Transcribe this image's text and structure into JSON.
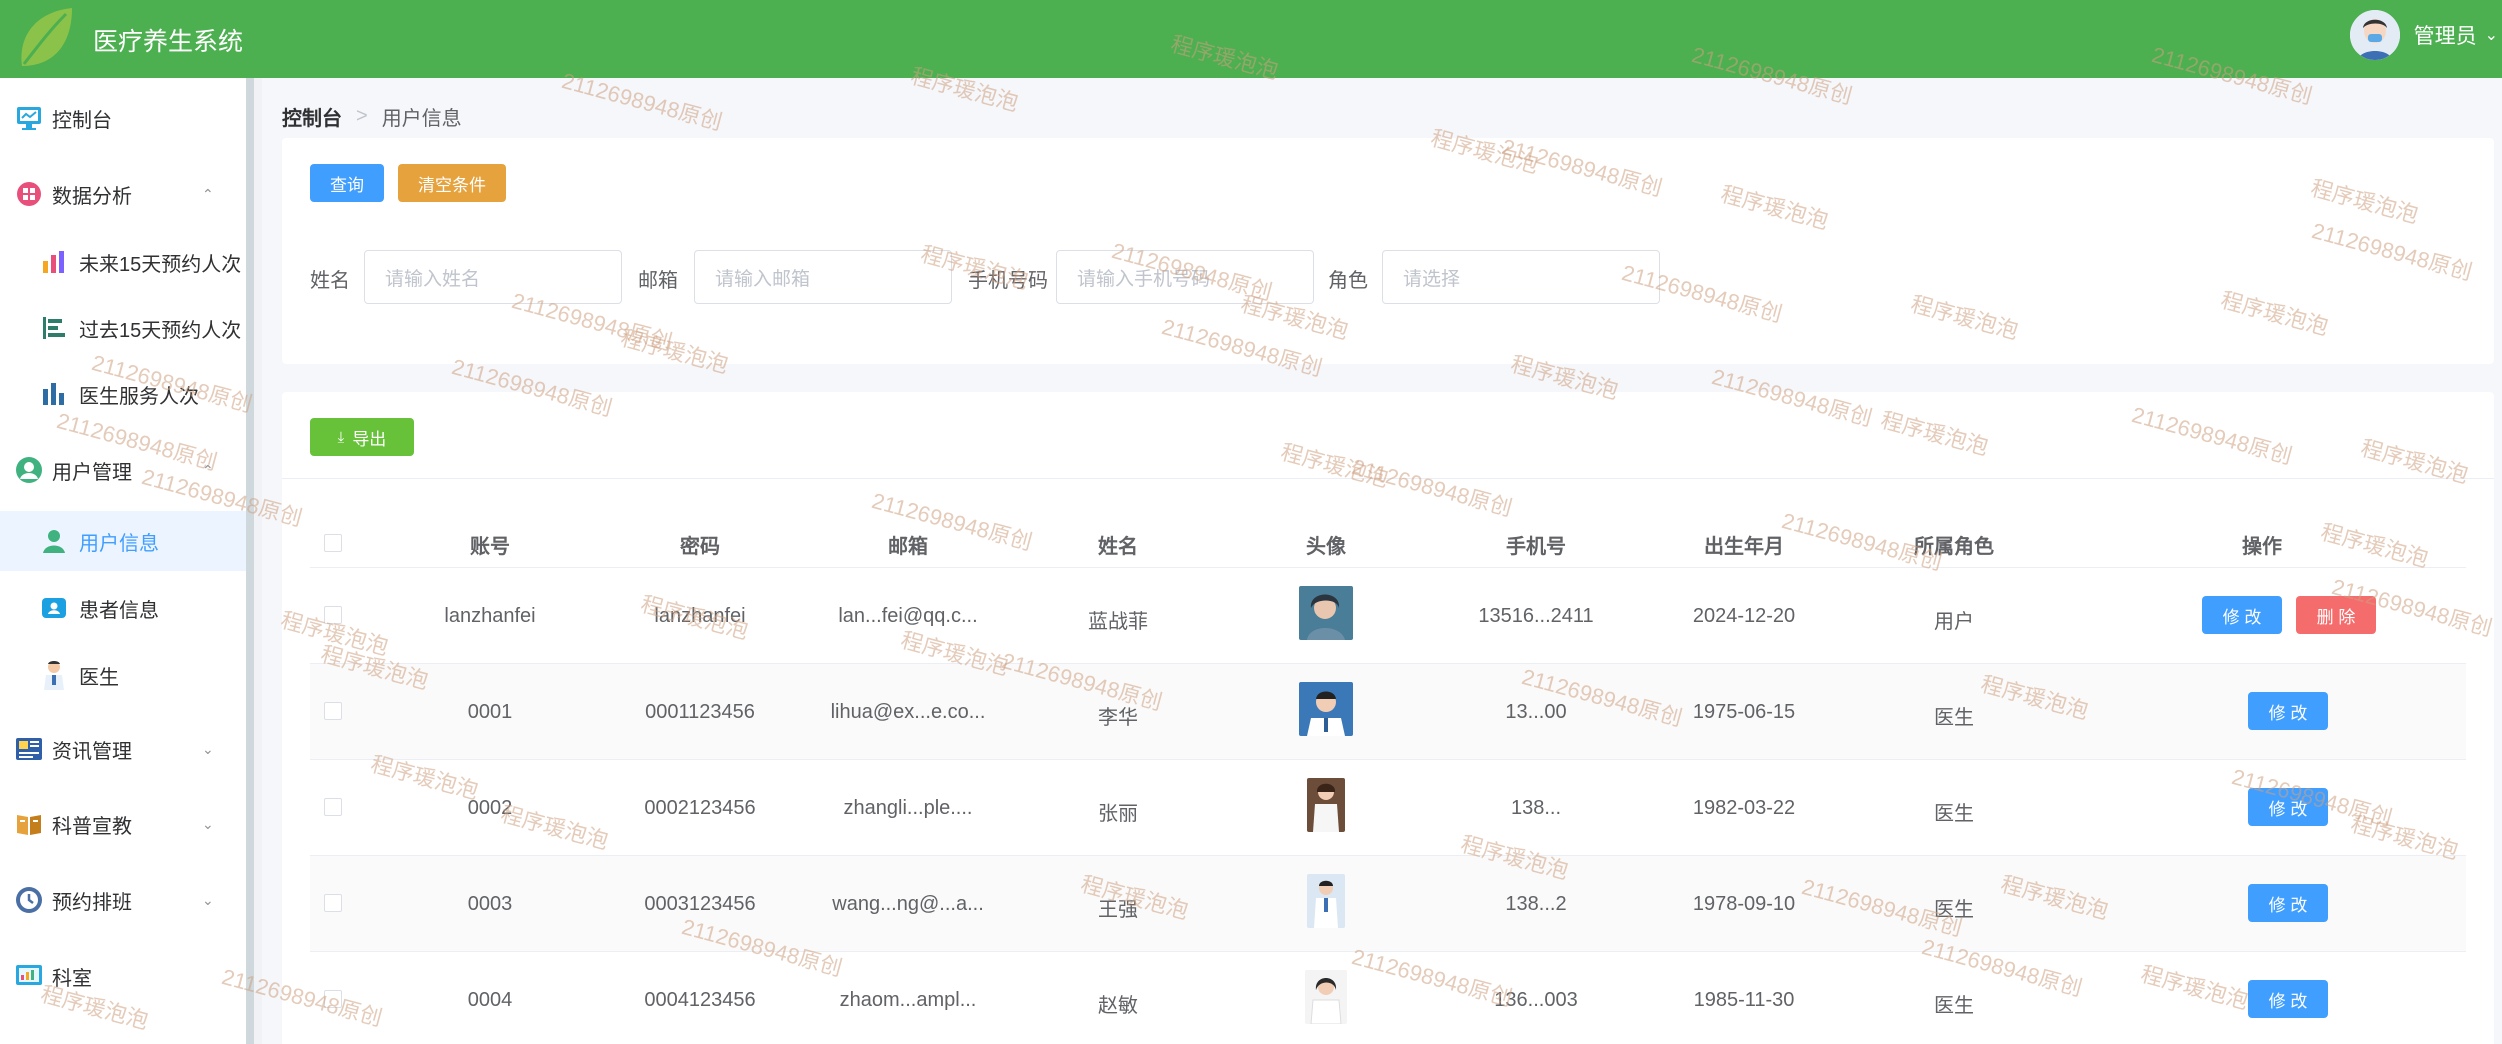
{
  "app": {
    "title": "医疗养生系统",
    "admin_name": "管理员"
  },
  "sidebar": {
    "items": [
      {
        "label": "控制台",
        "icon": "monitor-icon"
      },
      {
        "label": "数据分析",
        "icon": "chart-grid-icon",
        "expanded": true
      },
      {
        "label": "未来15天预约人次",
        "icon": "bar-chart-icon",
        "sub": true
      },
      {
        "label": "过去15天预约人次",
        "icon": "list-chart-icon",
        "sub": true
      },
      {
        "label": "医生服务人次",
        "icon": "column-chart-icon",
        "sub": true
      },
      {
        "label": "用户管理",
        "icon": "user-circle-icon",
        "expanded": true
      },
      {
        "label": "用户信息",
        "icon": "user-icon",
        "sub": true,
        "active": true
      },
      {
        "label": "患者信息",
        "icon": "id-card-icon",
        "sub": true
      },
      {
        "label": "医生",
        "icon": "doctor-icon",
        "sub": true
      },
      {
        "label": "资讯管理",
        "icon": "news-icon"
      },
      {
        "label": "科普宣教",
        "icon": "book-icon"
      },
      {
        "label": "预约排班",
        "icon": "schedule-icon"
      },
      {
        "label": "科室",
        "icon": "department-icon"
      }
    ]
  },
  "breadcrumb": {
    "home": "控制台",
    "current": "用户信息"
  },
  "search": {
    "query_label": "查询",
    "clear_label": "清空条件",
    "fields": [
      {
        "label": "姓名",
        "placeholder": "请输入姓名"
      },
      {
        "label": "邮箱",
        "placeholder": "请输入邮箱"
      },
      {
        "label": "手机号码",
        "placeholder": "请输入手机号码"
      },
      {
        "label": "角色",
        "placeholder": "请选择"
      }
    ]
  },
  "table": {
    "export_label": "导出",
    "headers": [
      "账号",
      "密码",
      "邮箱",
      "姓名",
      "头像",
      "手机号",
      "出生年月",
      "所属角色",
      "操作"
    ],
    "edit_label": "修 改",
    "delete_label": "删 除",
    "rows": [
      {
        "account": "lanzhanfei",
        "password": "lanzhanfei",
        "email": "lan...fei@qq.c...",
        "name": "蓝战菲",
        "phone": "13516...2411",
        "birth": "2024-12-20",
        "role": "用户",
        "deletable": true
      },
      {
        "account": "0001",
        "password": "0001123456",
        "email": "lihua@ex...e.co...",
        "name": "李华",
        "phone": "13...00",
        "birth": "1975-06-15",
        "role": "医生",
        "deletable": false
      },
      {
        "account": "0002",
        "password": "0002123456",
        "email": "zhangli...ple....",
        "name": "张丽",
        "phone": "138...",
        "birth": "1982-03-22",
        "role": "医生",
        "deletable": false
      },
      {
        "account": "0003",
        "password": "0003123456",
        "email": "wang...ng@...a...",
        "name": "王强",
        "phone": "138...2",
        "birth": "1978-09-10",
        "role": "医生",
        "deletable": false
      },
      {
        "account": "0004",
        "password": "0004123456",
        "email": "zhaom...ampl...",
        "name": "赵敏",
        "phone": "136...003",
        "birth": "1985-11-30",
        "role": "医生",
        "deletable": false
      }
    ]
  },
  "watermarks": [
    "2112698948原创",
    "程序瑗泡泡"
  ],
  "colors": {
    "header": "#4caf50",
    "primary": "#409eff",
    "warning": "#e6a23c",
    "success": "#67c23a",
    "danger": "#f56c6c"
  }
}
